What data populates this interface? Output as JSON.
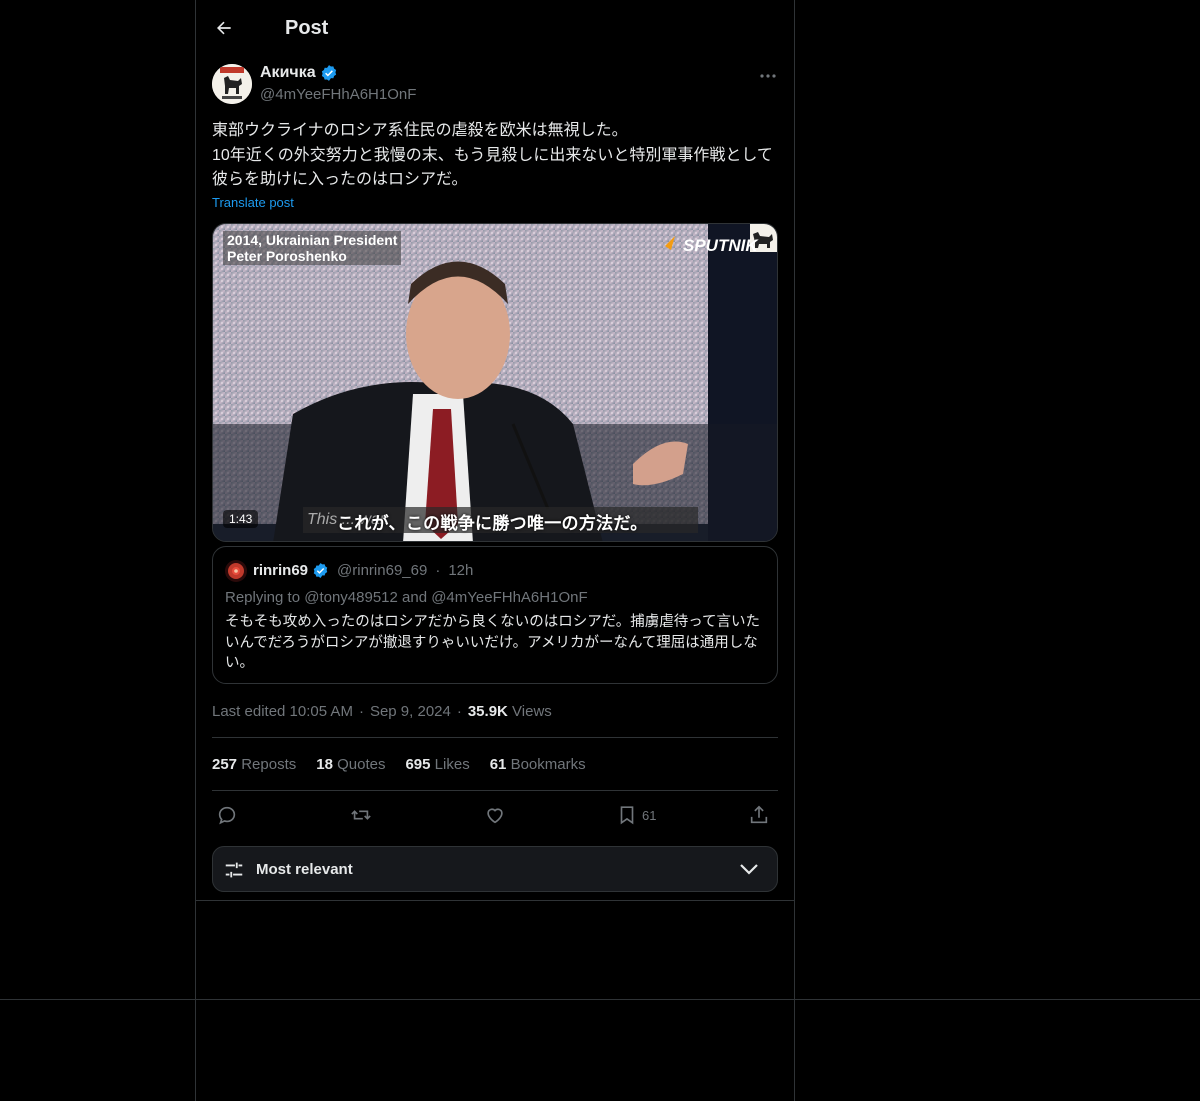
{
  "header": {
    "title": "Post"
  },
  "post": {
    "author": {
      "display_name": "Акичка",
      "handle": "@4mYeeFHhA6H1OnF",
      "verified": true
    },
    "text": "東部ウクライナのロシア系住民の虐殺を欧米は無視した。\n10年近くの外交努力と我慢の末、もう見殺しに出来ないと特別軍事作戦として彼らを助けに入ったのはロシアだ。",
    "translate_label": "Translate post",
    "video": {
      "caption_line1": "2014, Ukrainian President",
      "caption_line2": "Peter Poroshenko",
      "logo": "SPUTNIK",
      "duration": "1:43",
      "subtitle_en": "This ... war.",
      "subtitle_jp": "これが、この戦争に勝つ唯一の方法だ。"
    },
    "quote": {
      "display_name": "rinrin69",
      "handle": "@rinrin69_69",
      "separator": "·",
      "time": "12h",
      "replying_to": "Replying to @tony489512 and @4mYeeFHhA6H1OnF",
      "text": "そもそも攻め入ったのはロシアだから良くないのはロシアだ。捕虜虐待って言いたいんでだろうがロシアが撤退すりゃいいだけ。アメリカがーなんて理屈は通用しない。"
    },
    "meta": {
      "edited": "Last edited 10:05 AM",
      "sep": "·",
      "date": "Sep 9, 2024",
      "views_count": "35.9K",
      "views_label": "Views"
    },
    "stats": {
      "reposts_count": "257",
      "reposts_label": "Reposts",
      "quotes_count": "18",
      "quotes_label": "Quotes",
      "likes_count": "695",
      "likes_label": "Likes",
      "bookmarks_count": "61",
      "bookmarks_label": "Bookmarks"
    },
    "actions": {
      "bookmark_count": "61"
    }
  },
  "sort": {
    "label": "Most relevant"
  },
  "colors": {
    "accent": "#1d9bf0",
    "text": "#e7e9ea",
    "muted": "#71767b",
    "border": "#2f3336",
    "background": "#000000"
  }
}
